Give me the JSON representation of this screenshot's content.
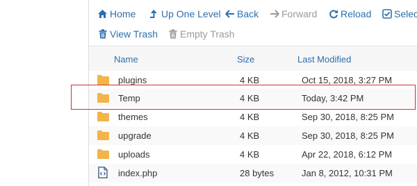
{
  "toolbar": {
    "home": "Home",
    "up_one_level": "Up One Level",
    "back": "Back",
    "forward": "Forward",
    "reload": "Reload",
    "select": "Select",
    "view_trash": "View Trash",
    "empty_trash": "Empty Trash"
  },
  "table": {
    "columns": {
      "name": "Name",
      "size": "Size",
      "modified": "Last Modified"
    },
    "rows": [
      {
        "name": "plugins",
        "size": "4 KB",
        "modified": "Oct 15, 2018, 3:27 PM",
        "icon": "folder-icon"
      },
      {
        "name": "Temp",
        "size": "4 KB",
        "modified": "Today, 3:42 PM",
        "icon": "folder-icon"
      },
      {
        "name": "themes",
        "size": "4 KB",
        "modified": "Sep 30, 2018, 8:25 PM",
        "icon": "folder-icon"
      },
      {
        "name": "upgrade",
        "size": "4 KB",
        "modified": "Sep 30, 2018, 8:25 PM",
        "icon": "folder-icon"
      },
      {
        "name": "uploads",
        "size": "4 KB",
        "modified": "Apr 22, 2018, 6:12 PM",
        "icon": "folder-icon"
      },
      {
        "name": "index.php",
        "size": "28 bytes",
        "modified": "Jan 8, 2012, 10:31 PM",
        "icon": "code-file-icon"
      }
    ]
  },
  "colors": {
    "link": "#2c6fad",
    "disabled": "#9a9a9a",
    "folder": "#f2b54a",
    "highlight": "#d02f2f"
  }
}
